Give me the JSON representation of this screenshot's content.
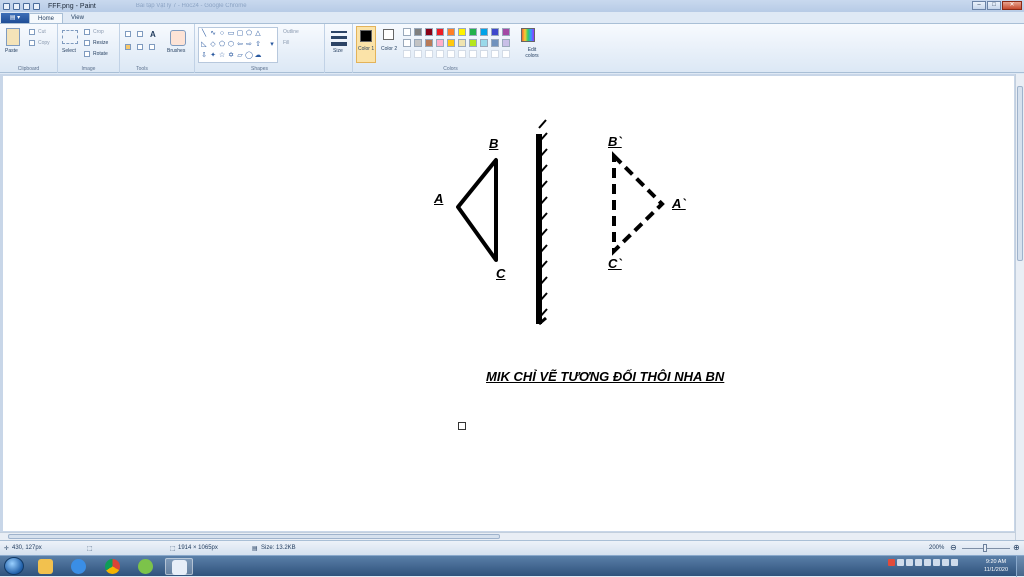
{
  "window": {
    "title": "FFF.png - Paint",
    "ghost_title": "Bài tập Vật lý 7 - Hoc24 - Google Chrome"
  },
  "ribbon": {
    "file_tab": "▤ ▾",
    "tabs": [
      "Home",
      "View"
    ],
    "clipboard": {
      "paste": "Paste",
      "cut": "Cut",
      "copy": "Copy",
      "label": "Clipboard"
    },
    "image": {
      "select": "Select",
      "crop": "Crop",
      "resize": "Resize",
      "rotate": "Rotate",
      "label": "Image"
    },
    "tools": {
      "label": "Tools",
      "brushes": "Brushes"
    },
    "shapes": {
      "outline": "Outline",
      "fill": "Fill",
      "label": "Shapes"
    },
    "size": {
      "label": "Size"
    },
    "colors": {
      "color1": "Color 1",
      "color2": "Color 2",
      "edit": "Edit colors",
      "label": "Colors",
      "palette_row1": [
        "#ffffff",
        "#7f7f7f",
        "#880015",
        "#ed1c24",
        "#ff7f27",
        "#fff200",
        "#22b14c",
        "#00a2e8",
        "#3f48cc",
        "#a349a4"
      ],
      "palette_row2": [
        "#ffffff",
        "#c3c3c3",
        "#b97a57",
        "#ffaec9",
        "#ffc90e",
        "#efe4b0",
        "#b5e61d",
        "#99d9ea",
        "#7092be",
        "#c8bfe7"
      ],
      "color1_value": "#000000",
      "color2_value": "#ffffff"
    }
  },
  "drawing": {
    "labels": {
      "A": "A",
      "B": "B",
      "C": "C",
      "A2": "A`",
      "B2": "B`",
      "C2": "C`"
    },
    "caption": "MIK CHỈ VẼ TƯƠNG ĐỐI THÔI NHA BN"
  },
  "status": {
    "cursor_pos": "430, 127px",
    "image_size": "1914 × 1065px",
    "file_size": "Size: 13.2KB",
    "zoom": "200%"
  },
  "taskbar": {
    "time": "9:20 AM",
    "date": "11/1/2020"
  }
}
